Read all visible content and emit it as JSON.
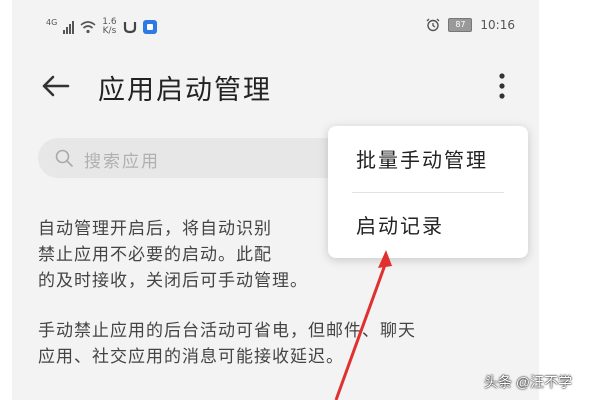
{
  "status_bar": {
    "network": "4G",
    "speed_value": "1.6",
    "speed_unit": "K/s",
    "battery": "87",
    "time": "10:16"
  },
  "header": {
    "title": "应用启动管理",
    "back_icon": "arrow-left-icon",
    "more_icon": "more-vertical-icon"
  },
  "search": {
    "placeholder": "搜索应用",
    "icon": "search-icon"
  },
  "main": {
    "paragraph1_line1": "自动管理开启后，将自动识别",
    "paragraph1_line2": "禁止应用不必要的启动。此配",
    "paragraph1_line3": "的及时接收，关闭后可手动管理。",
    "paragraph2_line1": "手动禁止应用的后台活动可省电，但邮件、聊天",
    "paragraph2_line2": "应用、社交应用的消息可能接收延迟。"
  },
  "menu": {
    "items": [
      {
        "label": "批量手动管理"
      },
      {
        "label": "启动记录"
      }
    ]
  },
  "watermark": "头条 @汪不学",
  "colors": {
    "background": "#f3f3f3",
    "annotation_arrow": "#e03030",
    "menu_background": "#ffffff"
  }
}
